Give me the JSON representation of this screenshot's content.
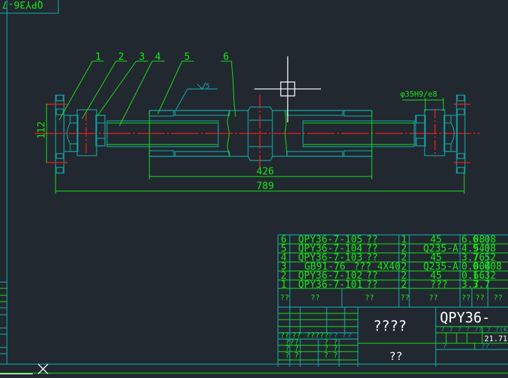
{
  "colors": {
    "background": "#212830",
    "outline": "#16a0a0",
    "lines": "#19e619",
    "centerline": "#ff1a1a",
    "cursor": "#ffffff"
  },
  "viewport_tag": "QPY36-7",
  "drawing": {
    "balloons": [
      "1",
      "2",
      "3",
      "4",
      "5",
      "6"
    ],
    "roughness": "5",
    "fit_label": "φ35H9/e8",
    "dims": {
      "height": "112",
      "inner": "426",
      "overall": "789"
    }
  },
  "bom": {
    "rows": [
      {
        "no": "6",
        "code": "QPY36-7-105",
        "name": "??",
        "qty": "1",
        "material": "45",
        "unit": "6.08",
        "total": "6.08"
      },
      {
        "no": "5",
        "code": "QPY36-7-104",
        "name": "??",
        "qty": "2",
        "material": "Q235-A",
        "unit": "4.54",
        "total": "9.08"
      },
      {
        "no": "4",
        "code": "QPY36-7-103",
        "name": "??",
        "qty": "2",
        "material": "45",
        "unit": "3.76",
        "total": "7.52"
      },
      {
        "no": "3",
        "code": "GB91-76",
        "name": "??? 4X40",
        "qty": "2",
        "material": "Q235-A",
        "unit": "0.004",
        "total": "0.008"
      },
      {
        "no": "2",
        "code": "QPY36-7-102",
        "name": "??",
        "qty": "2",
        "material": "45",
        "unit": "0.66",
        "total": "1.32"
      },
      {
        "no": "1",
        "code": "QPY36-7-101",
        "name": "??",
        "qty": "2",
        "material": "???",
        "unit": "3.7",
        "total": "3.7"
      }
    ],
    "header": [
      "??",
      "??",
      "??",
      "??",
      "??",
      "??",
      "??",
      "??"
    ]
  },
  "title_block": {
    "drawing_name": "????",
    "company": "??",
    "drawing_no": "QPY36-",
    "stage_header": "? ? ? ? ?? ? ?(kg)?",
    "weight": "21.71",
    "left_labels": [
      "??",
      "??",
      "?????",
      "?",
      "? ?",
      "?",
      "???",
      "? ?",
      "? ?",
      "? ?",
      "? ?",
      "? ?"
    ],
    "sheet_labels": [
      "?",
      "??"
    ]
  }
}
